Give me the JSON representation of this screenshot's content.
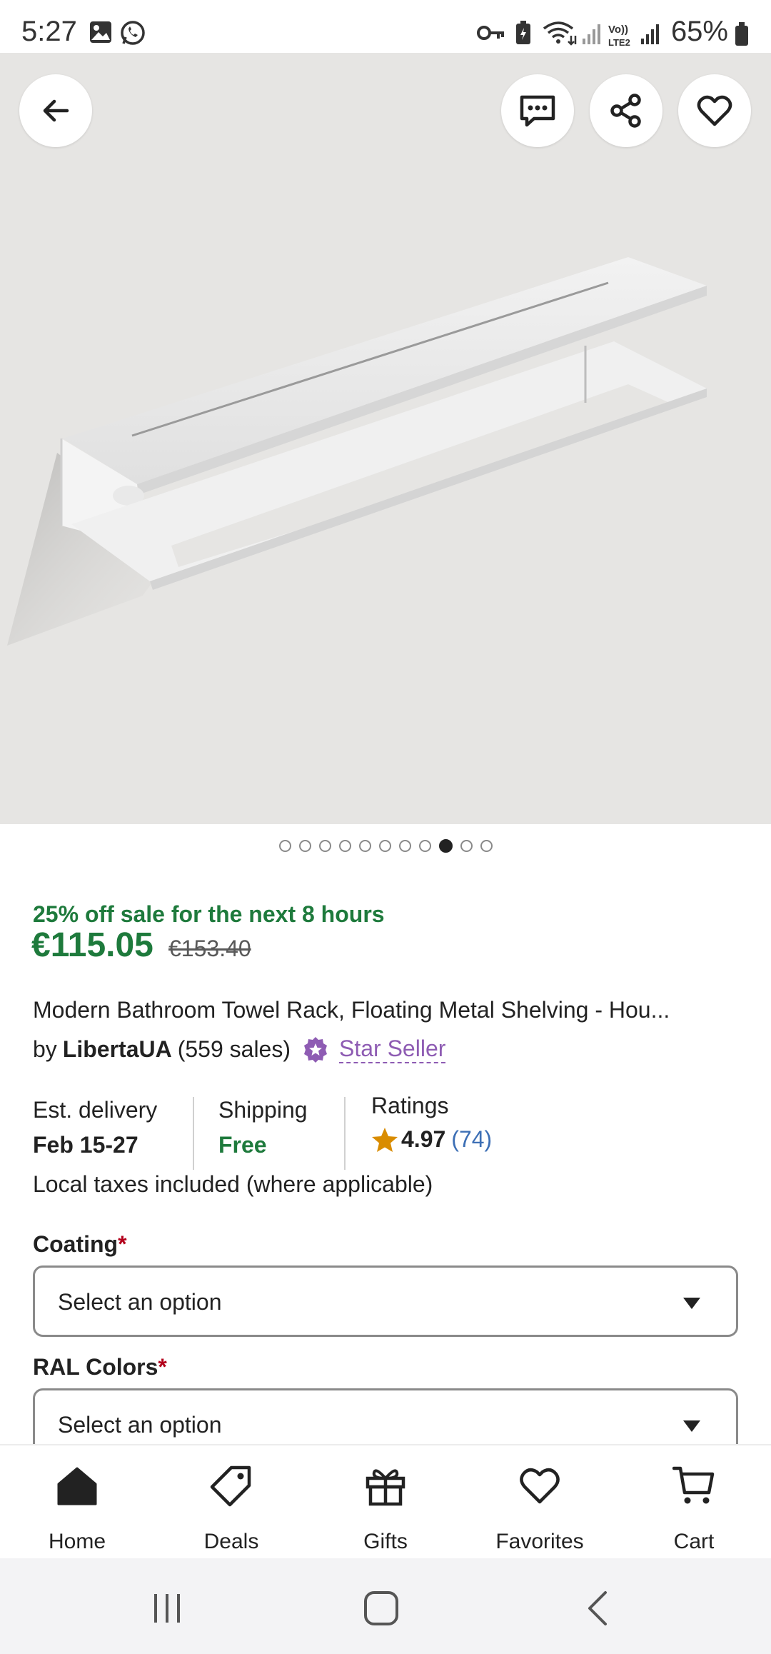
{
  "status_bar": {
    "time": "5:27",
    "battery": "65%"
  },
  "hero": {
    "carousel_total": 11,
    "carousel_active_index": 8
  },
  "sale": {
    "text": "25% off sale for the next  8 hours",
    "price": "€115.05",
    "original_price": "€153.40"
  },
  "product": {
    "title": "Modern Bathroom Towel Rack, Floating Metal Shelving - Hou...",
    "by": "by",
    "seller": "LibertaUA",
    "sales": "(559 sales)",
    "star_seller": "Star Seller"
  },
  "info": {
    "delivery_label": "Est. delivery",
    "delivery_value": "Feb 15-27",
    "shipping_label": "Shipping",
    "shipping_value": "Free",
    "ratings_label": "Ratings",
    "rating": "4.97",
    "rating_count": "(74)"
  },
  "taxes_note": "Local taxes included (where applicable)",
  "options": [
    {
      "label": "Coating",
      "required": "*",
      "placeholder": "Select an option"
    },
    {
      "label": "RAL Colors",
      "required": "*",
      "placeholder": "Select an option"
    }
  ],
  "nav": {
    "items": [
      {
        "label": "Home",
        "icon": "home-icon"
      },
      {
        "label": "Deals",
        "icon": "tag-icon"
      },
      {
        "label": "Gifts",
        "icon": "gift-icon"
      },
      {
        "label": "Favorites",
        "icon": "heart-icon"
      },
      {
        "label": "Cart",
        "icon": "cart-icon"
      }
    ]
  },
  "colors": {
    "sale_green": "#1e7a3c",
    "star_seller_purple": "#8e5cb3",
    "rating_star": "#d98c00",
    "link_blue": "#3d6fb5",
    "required_red": "#b3001b"
  }
}
